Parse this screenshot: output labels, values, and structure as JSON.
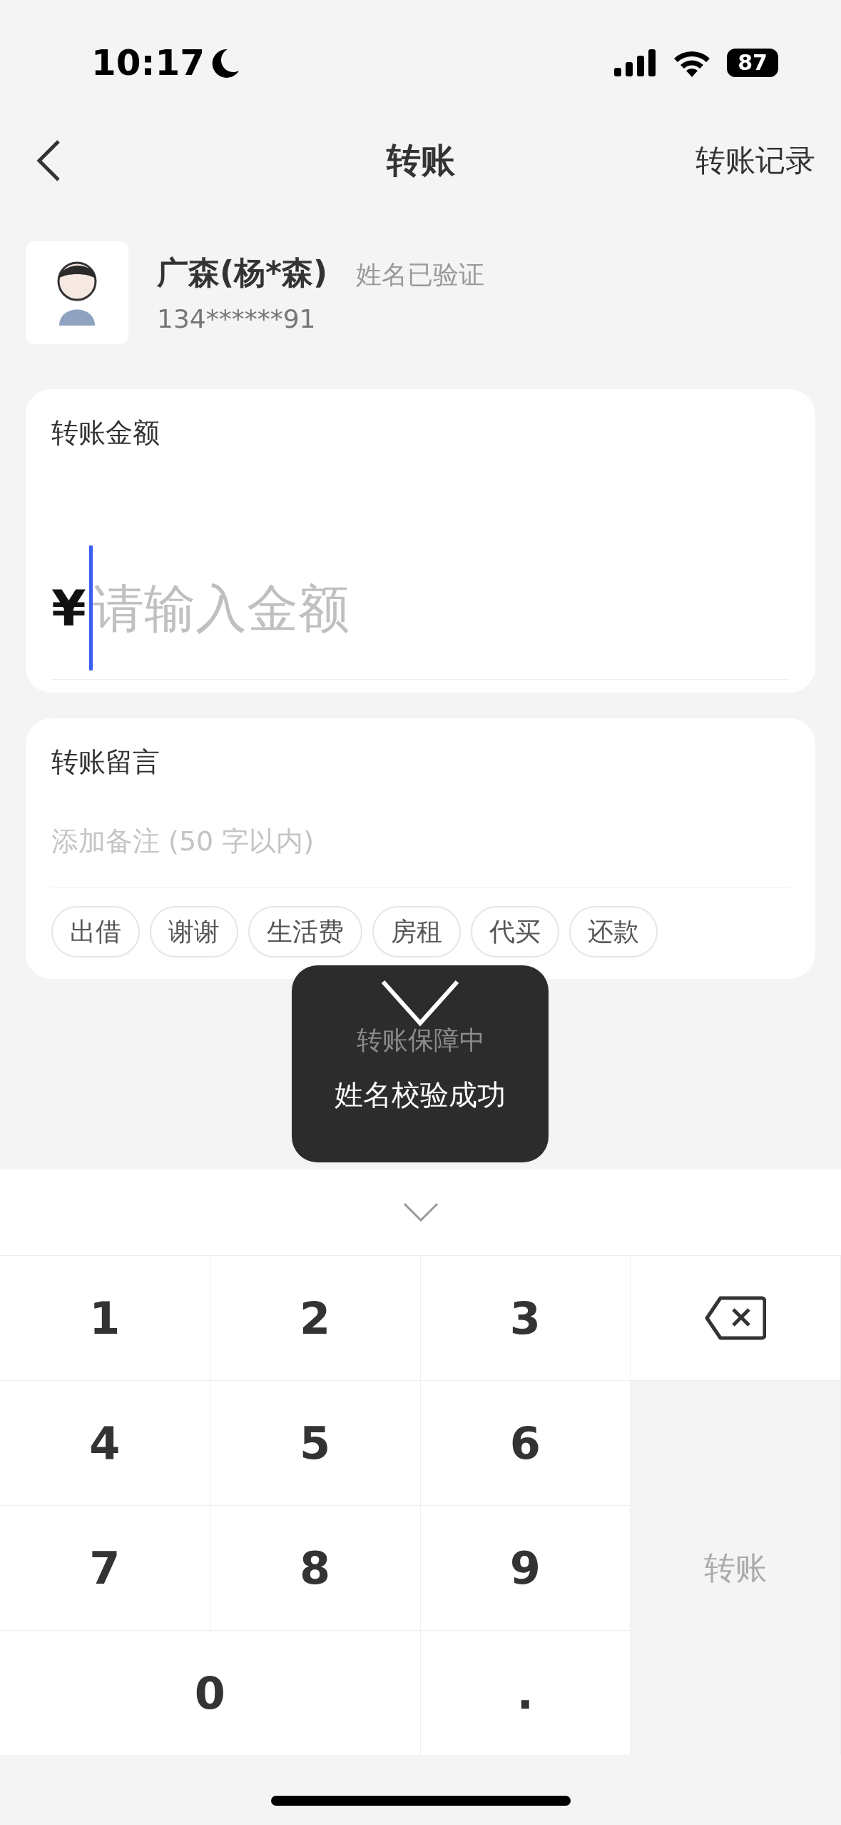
{
  "status_bar": {
    "time": "10:17",
    "battery": "87"
  },
  "nav": {
    "title": "转账",
    "action": "转账记录"
  },
  "payee": {
    "name": "广森(杨*森)",
    "verified_label": "姓名已验证",
    "phone": "134******91"
  },
  "amount": {
    "label": "转账金额",
    "currency": "¥",
    "placeholder": "请输入金额"
  },
  "note": {
    "label": "转账留言",
    "placeholder": "添加备注 (50 字以内)",
    "tags": [
      "出借",
      "谢谢",
      "生活费",
      "房租",
      "代买",
      "还款"
    ]
  },
  "guarantee_text": "转账保障中",
  "toast": {
    "message": "姓名校验成功"
  },
  "keypad": {
    "keys": [
      {
        "kind": "digit",
        "label": "1"
      },
      {
        "kind": "digit",
        "label": "2"
      },
      {
        "kind": "digit",
        "label": "3"
      },
      {
        "kind": "delete"
      },
      {
        "kind": "digit",
        "label": "4"
      },
      {
        "kind": "digit",
        "label": "5"
      },
      {
        "kind": "digit",
        "label": "6"
      },
      {
        "kind": "digit",
        "label": "7"
      },
      {
        "kind": "digit",
        "label": "8"
      },
      {
        "kind": "digit",
        "label": "9"
      },
      {
        "kind": "submit",
        "label": "转账",
        "disabled": true
      },
      {
        "kind": "wide",
        "label": "0"
      },
      {
        "kind": "digit",
        "label": "."
      }
    ]
  }
}
